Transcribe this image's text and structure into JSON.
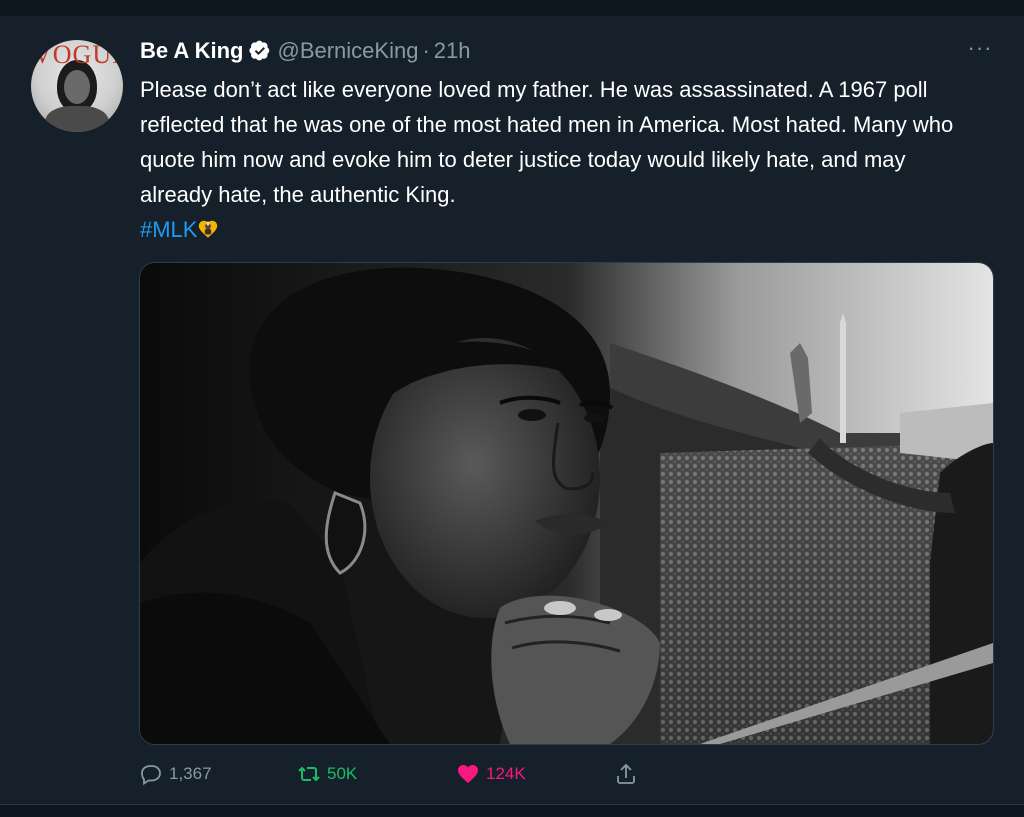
{
  "tweet": {
    "author_name": "Be A King",
    "handle": "@BerniceKing",
    "separator": "·",
    "time": "21h",
    "more_label": "···",
    "text": "Please don’t act like everyone loved my father. He was assassinated. A 1967 poll reflected that he was one of the most hated men in America. Most hated. Many who quote him now and evoke him to deter justice today would likely hate, and may already hate, the authentic King.",
    "hashtag": "#MLK",
    "avatar_logo": "VOGUE"
  },
  "actions": {
    "replies": "1,367",
    "retweets": "50K",
    "likes": "124K"
  },
  "icons": {
    "verified": "verified-badge-icon",
    "reply": "reply-bubble-icon",
    "retweet": "retweet-icon",
    "like": "heart-icon",
    "share": "share-icon"
  },
  "colors": {
    "background": "#15202b",
    "text": "#ffffff",
    "muted": "#8899a6",
    "link": "#1d9bf0",
    "retweet": "#17bf63",
    "like": "#f91880"
  }
}
